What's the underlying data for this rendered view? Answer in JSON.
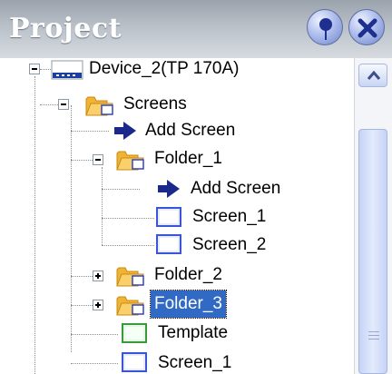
{
  "panel": {
    "title": "Project",
    "pin_icon": "pin-icon",
    "close_icon": "close-icon"
  },
  "tree": {
    "device": "Device_2(TP 170A)",
    "screens": "Screens",
    "add_screen_1": "Add Screen",
    "folder_1": "Folder_1",
    "add_screen_2": "Add Screen",
    "screen_1_in_folder": "Screen_1",
    "screen_2_in_folder": "Screen_2",
    "folder_2": "Folder_2",
    "folder_3": "Folder_3",
    "template": "Template",
    "screen_1": "Screen_1"
  },
  "colors": {
    "selection": "#316ac5",
    "folder": "#f5b942",
    "add_arrow": "#1b2a8a",
    "screen_icon": "#6f86e6",
    "template_icon": "#3a9a3a"
  }
}
